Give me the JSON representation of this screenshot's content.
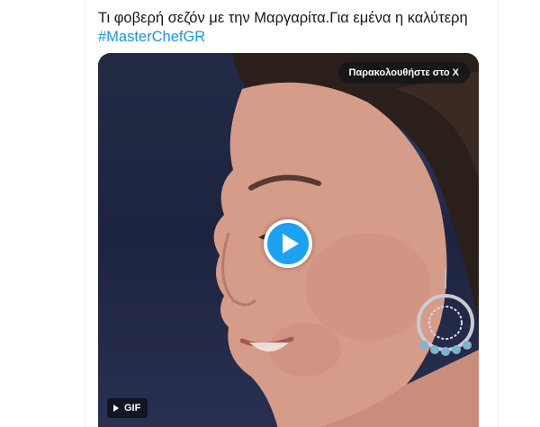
{
  "tweet": {
    "text_line1": "Τι φοβερή σεζόν με την Μαργαρίτα.Για εμένα η καλύτερη",
    "hashtag": "#MasterChefGR"
  },
  "media": {
    "watch_label": "Παρακολουθήστε στο X",
    "badge_label": "GIF",
    "play_icon": "play-icon"
  },
  "colors": {
    "accent": "#1da1f2",
    "hashtag": "#1b95e0",
    "text": "#14171a"
  }
}
